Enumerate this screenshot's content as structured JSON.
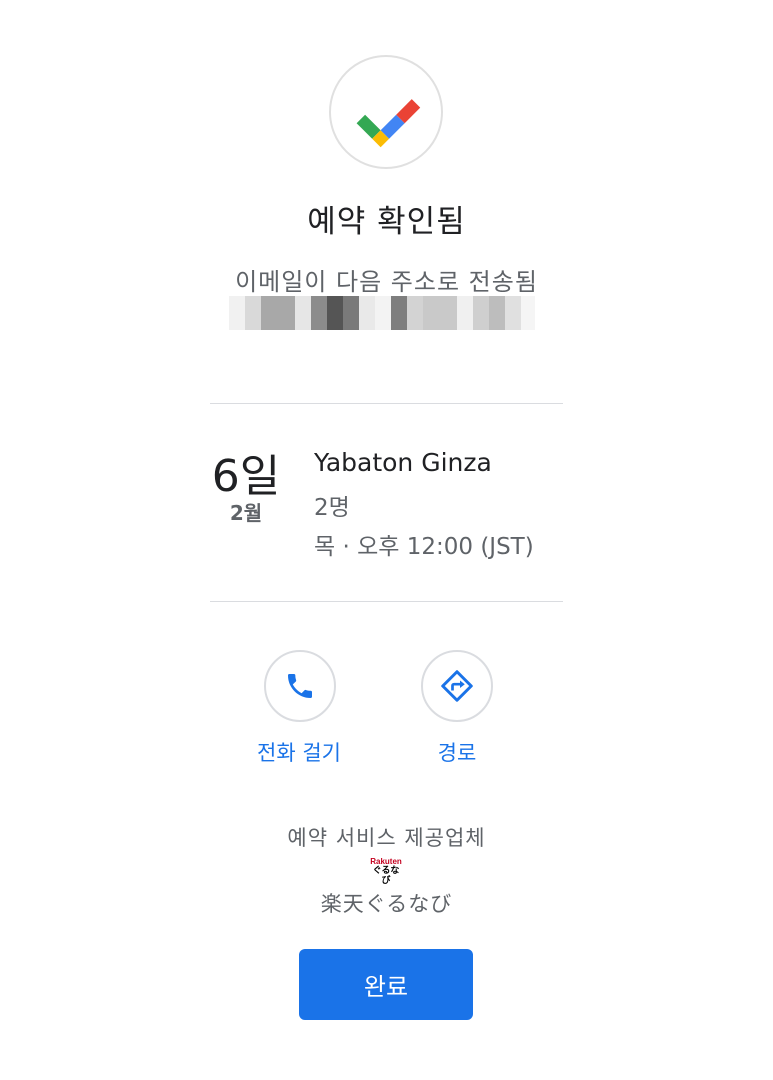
{
  "header": {
    "title": "예약 확인됨",
    "subtitle": "이메일이 다음 주소로 전송됨"
  },
  "reservation": {
    "day": "6일",
    "month": "2월",
    "restaurant": "Yabaton Ginza",
    "party_size": "2명",
    "time": "목 · 오후 12:00 (JST)"
  },
  "actions": {
    "call_label": "전화 걸기",
    "directions_label": "경로"
  },
  "provider": {
    "label": "예약 서비스 제공업체",
    "logo_line1": "Rakuten",
    "logo_line2": "ぐるなび",
    "name": "楽天ぐるなび"
  },
  "footer": {
    "done_label": "완료"
  },
  "colors": {
    "accent": "#1a73e8",
    "google_blue": "#4285f4",
    "google_red": "#ea4335",
    "google_yellow": "#fbbc04",
    "google_green": "#34a853"
  },
  "icons": {
    "check": "google-checkmark-icon",
    "call": "phone-icon",
    "directions": "directions-icon"
  }
}
